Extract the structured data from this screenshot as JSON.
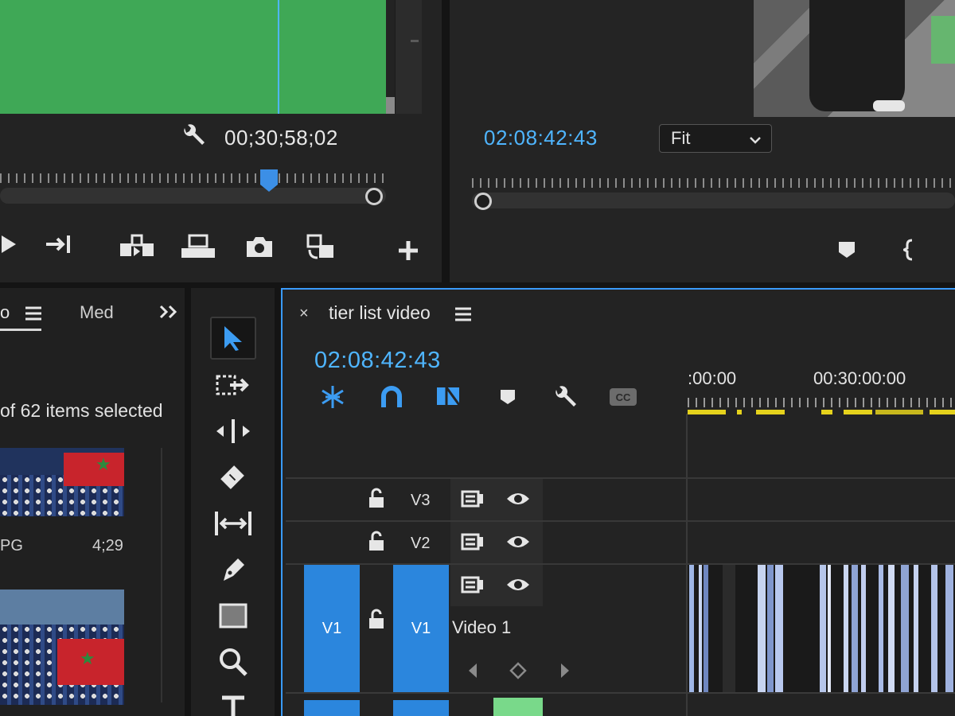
{
  "source_monitor": {
    "timecode": "00;30;58;02"
  },
  "program_monitor": {
    "timecode": "02:08:42:43",
    "zoom": "Fit"
  },
  "project_panel": {
    "tab_project_fragment": "o",
    "tab_media_fragment": "Med",
    "selection_status": "of 62 items selected",
    "items": [
      {
        "name_fragment": "PG",
        "duration": "4;29"
      },
      {
        "name_fragment": "",
        "duration": ""
      }
    ]
  },
  "timeline": {
    "title": "tier list video",
    "close_glyph": "×",
    "timecode": "02:08:42:43",
    "ruler_labels": [
      ":00:00",
      "00:30:00:00"
    ],
    "tracks": [
      {
        "id": "V3",
        "source": ""
      },
      {
        "id": "V2",
        "source": ""
      },
      {
        "id": "V1",
        "source": "V1",
        "name": "Video 1"
      }
    ]
  },
  "colors": {
    "accent": "#4fb5ff",
    "panel_border_active": "#3a9bff",
    "track_target": "#2b86dd",
    "work_area": "#e5d21c",
    "clip_green": "#79d98a",
    "source_frame": "#3fa856"
  }
}
